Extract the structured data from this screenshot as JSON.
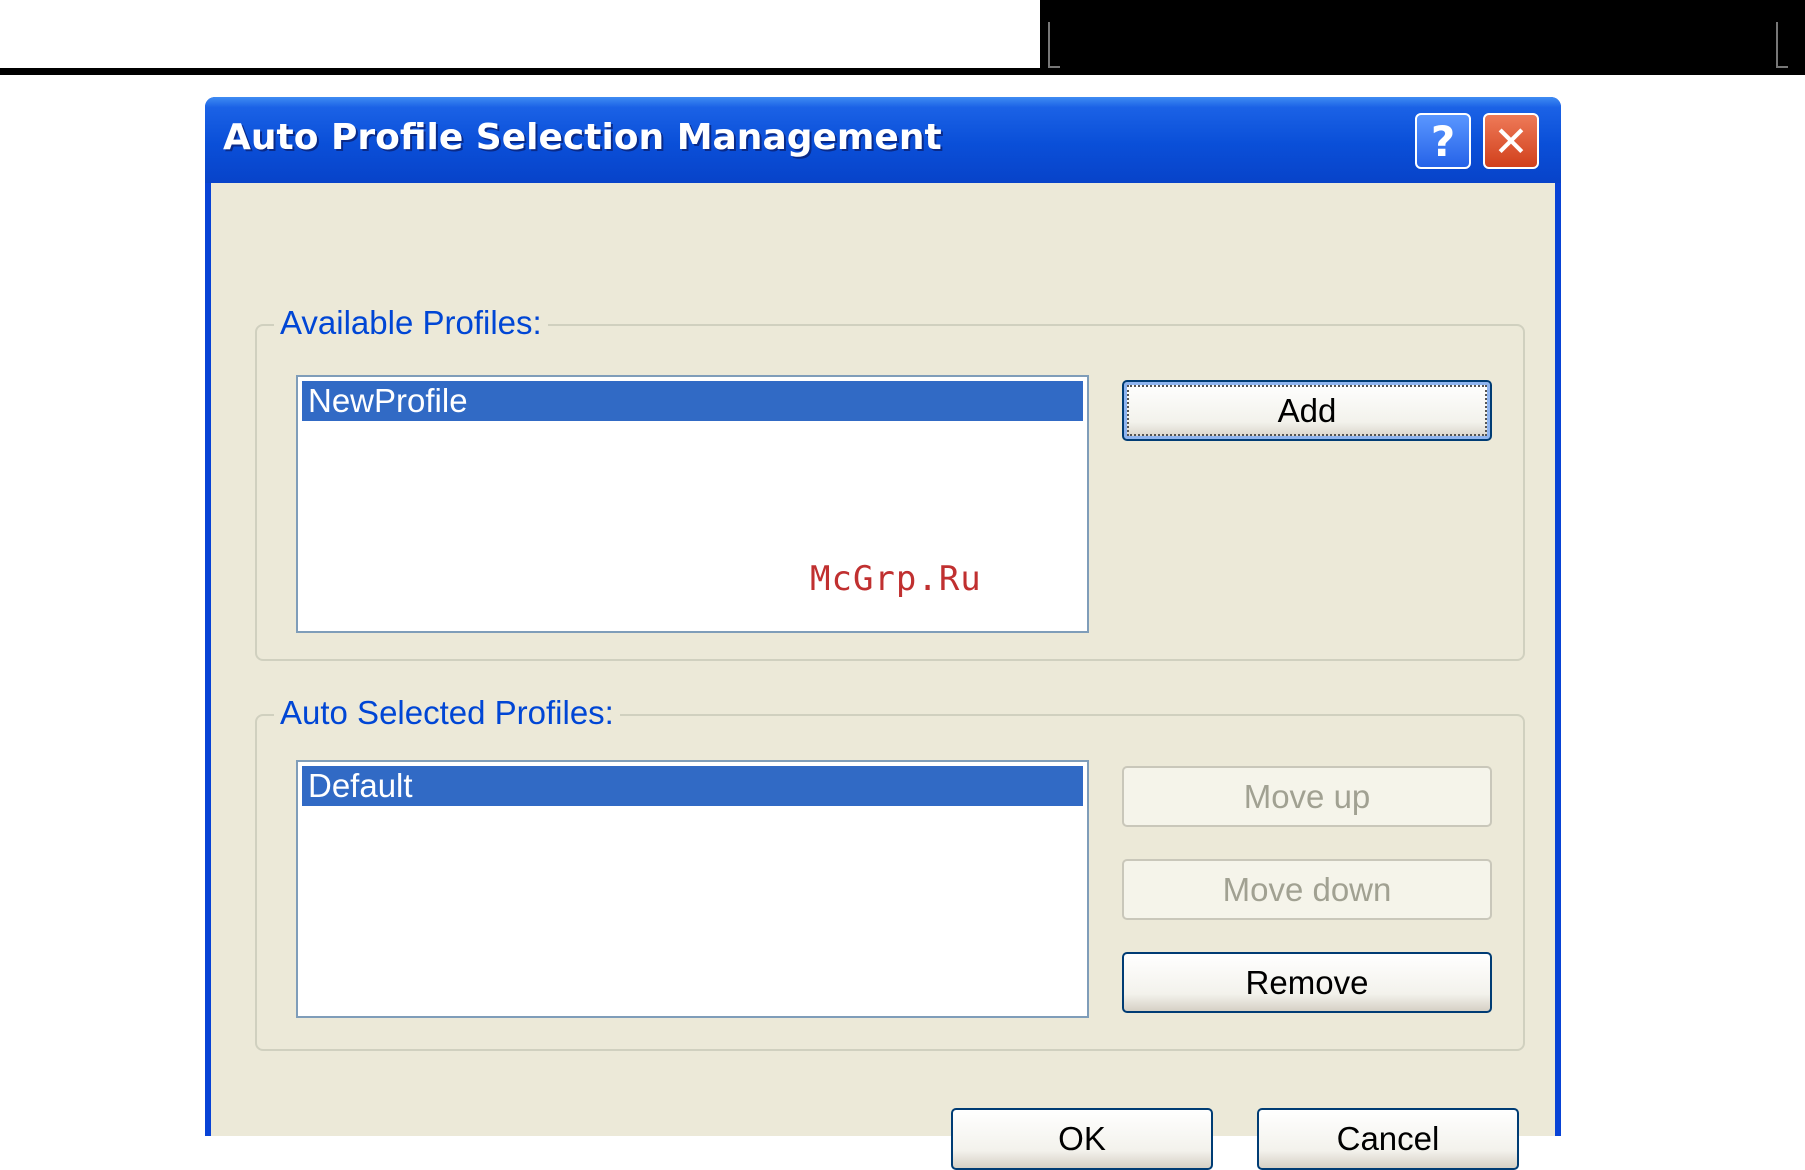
{
  "window": {
    "title": "Auto Profile Selection Management",
    "help_glyph": "?",
    "close_glyph": "✕"
  },
  "available": {
    "label": "Available Profiles:",
    "items": [
      "NewProfile"
    ],
    "add_label": "Add"
  },
  "auto_selected": {
    "label": "Auto Selected Profiles:",
    "items": [
      "Default"
    ],
    "move_up_label": "Move up",
    "move_down_label": "Move down",
    "remove_label": "Remove"
  },
  "footer": {
    "ok_label": "OK",
    "cancel_label": "Cancel"
  },
  "watermark": "McGrp.Ru",
  "colors": {
    "title_bar": "#0a4fd8",
    "selection": "#316ac5",
    "group_label": "#0046d5"
  }
}
